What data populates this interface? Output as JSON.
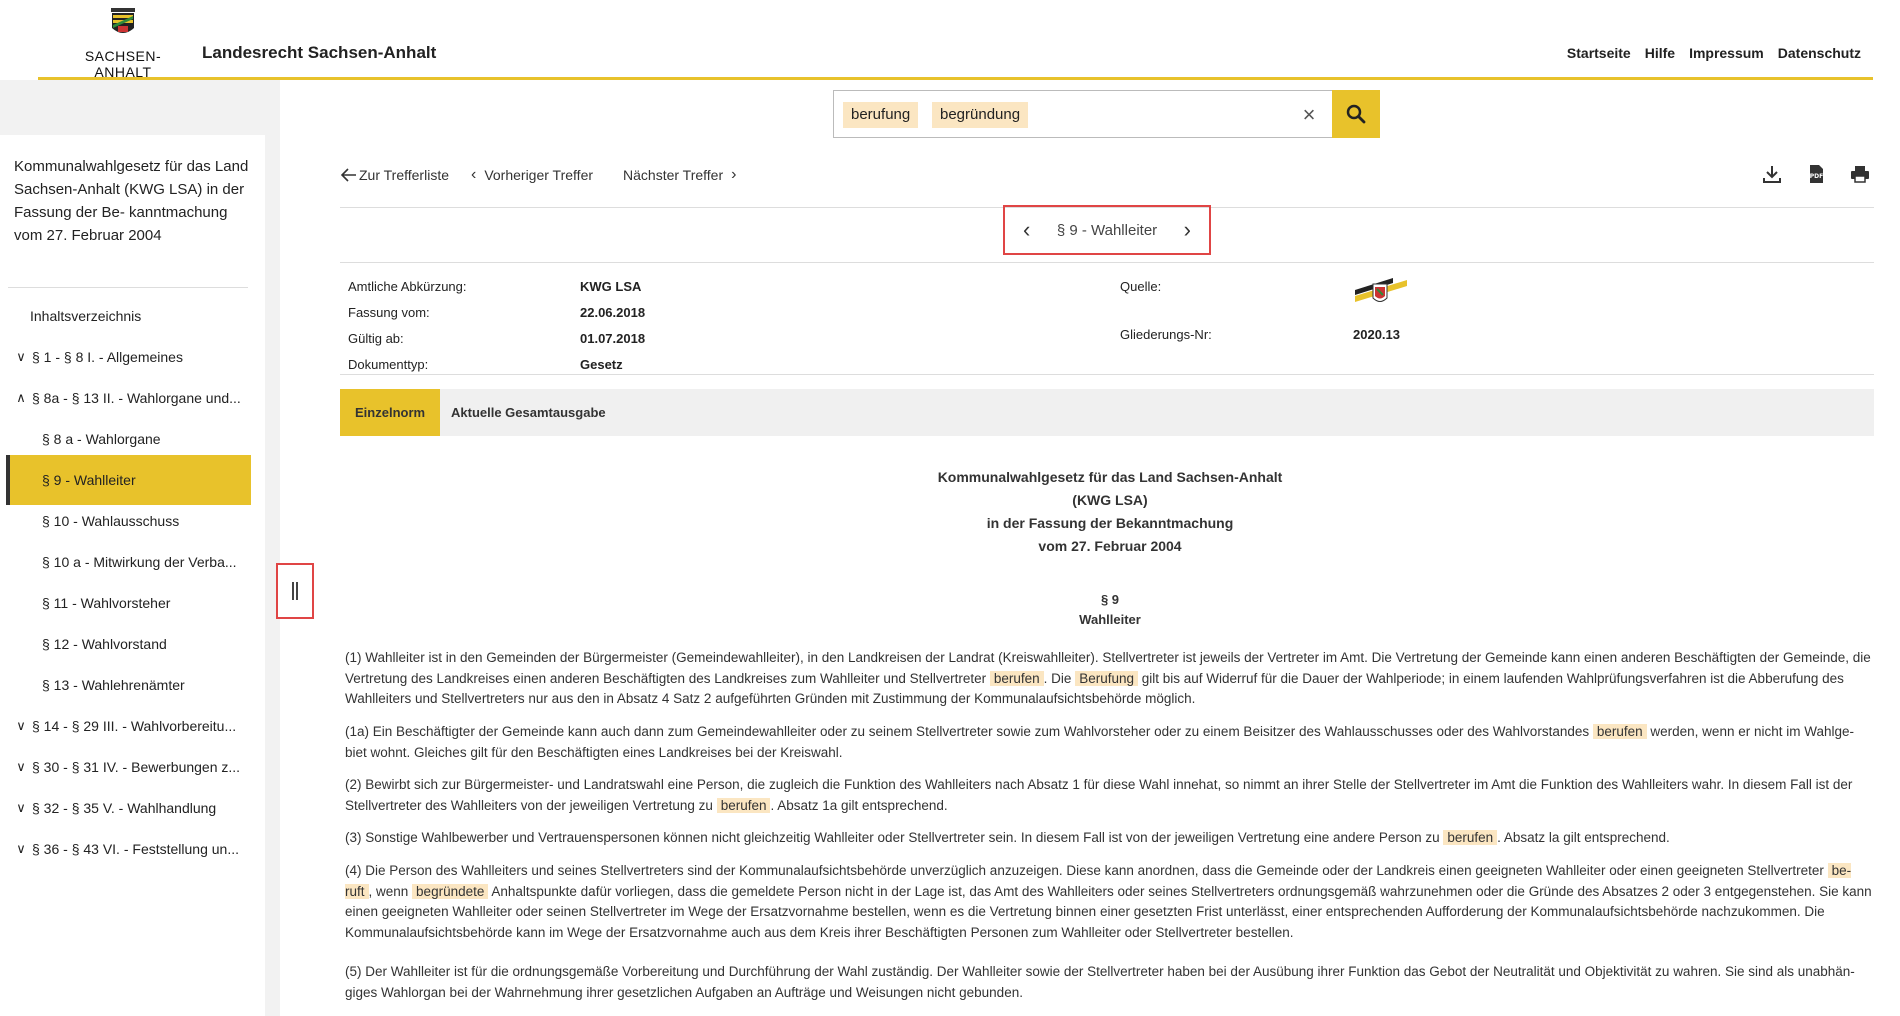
{
  "header": {
    "logo_text": "SACHSEN-ANHALT",
    "site_title": "Landesrecht Sachsen-Anhalt",
    "nav": [
      "Startseite",
      "Hilfe",
      "Impressum",
      "Datenschutz"
    ]
  },
  "sidebar": {
    "doc_title": "Kommunalwahlgesetz für das Land Sachsen-Anhalt (KWG LSA) in der Fassung der Be- kanntmachung vom 27. Februar 2004",
    "toc": [
      {
        "label": "Inhaltsverzeichnis",
        "type": "plain"
      },
      {
        "label": "§ 1 - § 8 I. - Allgemeines",
        "type": "collapsed"
      },
      {
        "label": "§ 8a - § 13 II. - Wahlorgane und...",
        "type": "expanded"
      },
      {
        "label": "§ 8 a - Wahlorgane",
        "type": "child"
      },
      {
        "label": "§ 9 - Wahlleiter",
        "type": "active"
      },
      {
        "label": "§ 10 - Wahlausschuss",
        "type": "child"
      },
      {
        "label": "§ 10 a - Mitwirkung der Verba...",
        "type": "child"
      },
      {
        "label": "§ 11 - Wahlvorsteher",
        "type": "child"
      },
      {
        "label": "§ 12 - Wahlvorstand",
        "type": "child"
      },
      {
        "label": "§ 13 - Wahlehrenämter",
        "type": "child"
      },
      {
        "label": "§ 14 - § 29 III. - Wahlvorbereitu...",
        "type": "collapsed"
      },
      {
        "label": "§ 30 - § 31 IV. - Bewerbungen z...",
        "type": "collapsed"
      },
      {
        "label": "§ 32 - § 35 V. - Wahlhandlung",
        "type": "collapsed"
      },
      {
        "label": "§ 36 - § 43 VI. - Feststellung un...",
        "type": "collapsed"
      }
    ]
  },
  "search": {
    "chips": [
      "berufung",
      "begründung"
    ]
  },
  "navigation": {
    "back": "Zur Trefferliste",
    "prev": "Vorheriger Treffer",
    "next": "Nächster Treffer"
  },
  "section_pager": {
    "label": "§ 9 - Wahlleiter"
  },
  "meta": {
    "abbr_label": "Amtliche Abkürzung:",
    "abbr_value": "KWG LSA",
    "version_label": "Fassung vom:",
    "version_value": "22.06.2018",
    "valid_label": "Gültig ab:",
    "valid_value": "01.07.2018",
    "type_label": "Dokumenttyp:",
    "type_value": "Gesetz",
    "source_label": "Quelle:",
    "gliederung_label": "Gliederungs-Nr:",
    "gliederung_value": "2020.13"
  },
  "tabs": [
    "Einzelnorm",
    "Aktuelle Gesamtausgabe"
  ],
  "document": {
    "head_lines": [
      "Kommunalwahlgesetz für das Land Sachsen-Anhalt",
      "(KWG LSA)",
      "in der Fassung der Bekanntmachung",
      "vom 27. Februar 2004"
    ],
    "section_number": "§ 9",
    "section_title": "Wahlleiter",
    "p1_a": "(1) Wahlleiter ist in den Gemeinden der Bürgermeister (Gemeindewahlleiter), in den Landkreisen der Landrat (Kreiswahlleiter). Stellvertreter ist jeweils der Vertreter im Amt. Die Vertretung der Gemeinde kann einen anderen Beschäftigten der Gemeinde, die Vertretung des Landkreises einen anderen Beschäftigten des Landkreises zum Wahlleiter und Stellvertreter ",
    "p1_h1": "berufen",
    "p1_b": ". Die ",
    "p1_h2": "Berufung",
    "p1_c": " gilt bis auf Widerruf für die Dauer der Wahlperiode; in einem laufenden Wahlprüfungsverfahren ist die Abberufung des Wahlleiters und Stellvertreters nur aus den in Absatz 4 Satz 2 aufgeführten Gründen mit Zustimmung der Kommunalaufsichtsbehörde möglich.",
    "p2_a": "(1a) Ein Beschäftigter der Gemeinde kann auch dann zum Gemeindewahlleiter oder zu seinem Stellvertreter sowie zum Wahlvorsteher oder zu einem Beisitzer des Wahlausschusses oder des Wahlvorstandes ",
    "p2_h1": "berufen",
    "p2_b": " werden, wenn er nicht im Wahlge- biet wohnt. Gleiches gilt für den Beschäftigten eines Landkreises bei der Kreiswahl.",
    "p3_a": "(2) Bewirbt sich zur Bürgermeister- und Landratswahl eine Person, die zugleich die Funktion des Wahlleiters nach Absatz 1 für diese Wahl innehat, so nimmt an ihrer Stelle der Stellvertreter im Amt die Funktion des Wahlleiters wahr. In diesem Fall ist der Stellvertreter des Wahlleiters von der jeweiligen Vertretung zu ",
    "p3_h1": "berufen",
    "p3_b": ". Absatz 1a gilt entsprechend.",
    "p4_a": "(3) Sonstige Wahlbewerber und Vertrauenspersonen können nicht gleichzeitig Wahlleiter oder Stellvertreter sein. In diesem Fall ist von der jeweiligen Vertretung eine andere Person zu ",
    "p4_h1": "berufen",
    "p4_b": ". Absatz la gilt entsprechend.",
    "p5_a": "(4) Die Person des Wahlleiters und seines Stellvertreters sind der Kommunalaufsichtsbehörde unverzüglich anzuzeigen. Diese kann anordnen, dass die Gemeinde oder der Landkreis einen geeigneten Wahlleiter oder einen geeigneten Stellvertreter ",
    "p5_h1": "be- ruft",
    "p5_b": ", wenn ",
    "p5_h2": "begründete",
    "p5_c": " Anhaltspunkte dafür vorliegen, dass die gemeldete Person nicht in der Lage ist, das Amt des Wahlleiters oder seines Stellvertreters ordnungsgemäß wahrzunehmen oder die Gründe des Absatzes 2 oder 3 entgegenstehen. Sie kann einen geeigneten Wahlleiter oder seinen Stellvertreter im Wege der Ersatzvornahme bestellen, wenn es die Vertretung binnen einer gesetzten Frist unterlässt, einer entsprechenden Aufforderung der Kommunalaufsichtsbehörde nachzukommen. Die Kommunalaufsichtsbehörde kann im Wege der Ersatzvornahme auch aus dem Kreis ihrer Beschäftigten Personen zum Wahlleiter oder Stellvertreter bestellen.",
    "p6": "(5) Der Wahlleiter ist für die ordnungsgemäße Vorbereitung und Durchführung der Wahl zuständig. Der Wahlleiter sowie der Stellvertreter haben bei der Ausübung ihrer Funktion das Gebot der Neutralität und Objektivität zu wahren. Sie sind als unabhän- giges Wahlorgan bei der Wahrnehmung ihrer gesetzlichen Aufgaben an Aufträge und Weisungen nicht gebunden."
  }
}
